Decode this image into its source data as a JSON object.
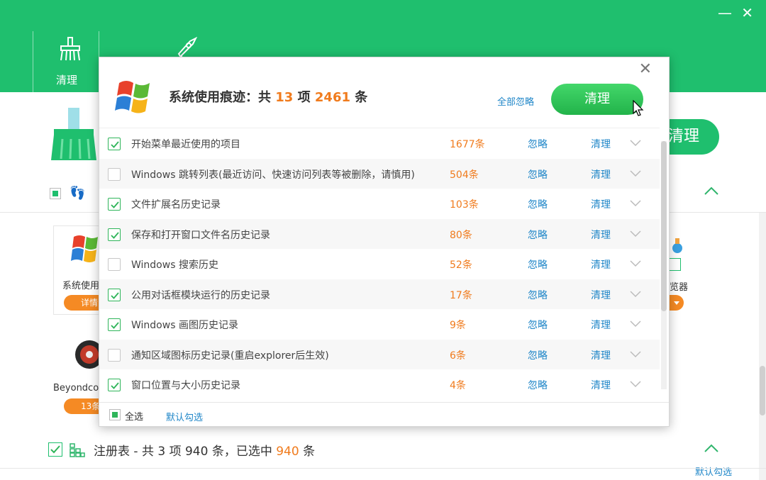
{
  "window": {
    "minimize": "—",
    "close": "✕"
  },
  "nav": {
    "tabs": [
      {
        "label": "清理",
        "icon": "broom-icon"
      },
      {
        "label": "",
        "icon": "rocket-icon"
      }
    ]
  },
  "background": {
    "clean_button": "清理",
    "trace_section_partial": "痕",
    "card_system_label": "系统使用",
    "card_system_button": "详情",
    "card_beyond_label": "Beyondco",
    "card_beyond_button": "13条",
    "card_browser_label": "览器",
    "registry": {
      "prefix": "注册表 - 共 3 项 940 条，已选中 ",
      "selected": "940",
      "suffix": " 条"
    },
    "default_check": "默认勾选"
  },
  "modal": {
    "title": {
      "prefix": "系统使用痕迹：共 ",
      "items": "13",
      "middle": " 项 ",
      "count": "2461",
      "suffix": " 条"
    },
    "ignore_all": "全部忽略",
    "clean_button": "清理",
    "close": "✕",
    "rows": [
      {
        "label": "开始菜单最近使用的项目",
        "count": "1677条",
        "checked": true,
        "ignore": "忽略",
        "clean": "清理"
      },
      {
        "label": "Windows 跳转列表(最近访问、快速访问列表等被删除，请慎用)",
        "count": "504条",
        "checked": false,
        "ignore": "忽略",
        "clean": "清理"
      },
      {
        "label": "文件扩展名历史记录",
        "count": "103条",
        "checked": true,
        "ignore": "忽略",
        "clean": "清理"
      },
      {
        "label": "保存和打开窗口文件名历史记录",
        "count": "80条",
        "checked": true,
        "ignore": "忽略",
        "clean": "清理"
      },
      {
        "label": "Windows 搜索历史",
        "count": "52条",
        "checked": false,
        "ignore": "忽略",
        "clean": "清理"
      },
      {
        "label": "公用对话框模块运行的历史记录",
        "count": "17条",
        "checked": true,
        "ignore": "忽略",
        "clean": "清理"
      },
      {
        "label": "Windows 画图历史记录",
        "count": "9条",
        "checked": true,
        "ignore": "忽略",
        "clean": "清理"
      },
      {
        "label": "通知区域图标历史记录(重启explorer后生效)",
        "count": "6条",
        "checked": false,
        "ignore": "忽略",
        "clean": "清理"
      },
      {
        "label": "窗口位置与大小历史记录",
        "count": "4条",
        "checked": true,
        "ignore": "忽略",
        "clean": "清理"
      }
    ],
    "footer": {
      "select_all": "全选",
      "default_select": "默认勾选"
    }
  },
  "colors": {
    "brand_green": "#1fbf6e",
    "orange": "#f07b1d",
    "link_blue": "#1f86c8"
  }
}
